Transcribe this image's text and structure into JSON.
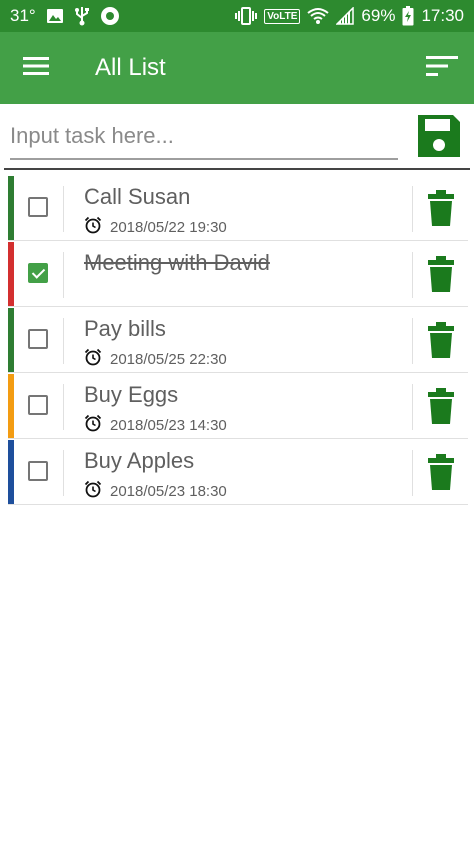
{
  "status_bar": {
    "temperature": "31°",
    "volte": "VoLTE",
    "battery": "69%",
    "time": "17:30"
  },
  "app_bar": {
    "title": "All List",
    "menu_icon": "hamburger-menu-icon",
    "sort_icon": "sort-icon"
  },
  "input": {
    "placeholder": "Input task here...",
    "value": "",
    "save_icon": "floppy-disk-icon"
  },
  "colors": {
    "status_bar": "#2d8a2f",
    "app_bar": "#43a047",
    "accent": "#1b7a1d",
    "text": "#5f5f5f"
  },
  "tasks": [
    {
      "title": "Call Susan",
      "time": "2018/05/22 19:30",
      "checked": false,
      "priority_color": "#2e7d32"
    },
    {
      "title": "Meeting with David",
      "time": "",
      "checked": true,
      "priority_color": "#d32f2f"
    },
    {
      "title": "Pay bills",
      "time": "2018/05/25 22:30",
      "checked": false,
      "priority_color": "#2e7d32"
    },
    {
      "title": "Buy Eggs",
      "time": "2018/05/23 14:30",
      "checked": false,
      "priority_color": "#f39c12"
    },
    {
      "title": "Buy Apples",
      "time": "2018/05/23 18:30",
      "checked": false,
      "priority_color": "#1e4f9c"
    }
  ]
}
